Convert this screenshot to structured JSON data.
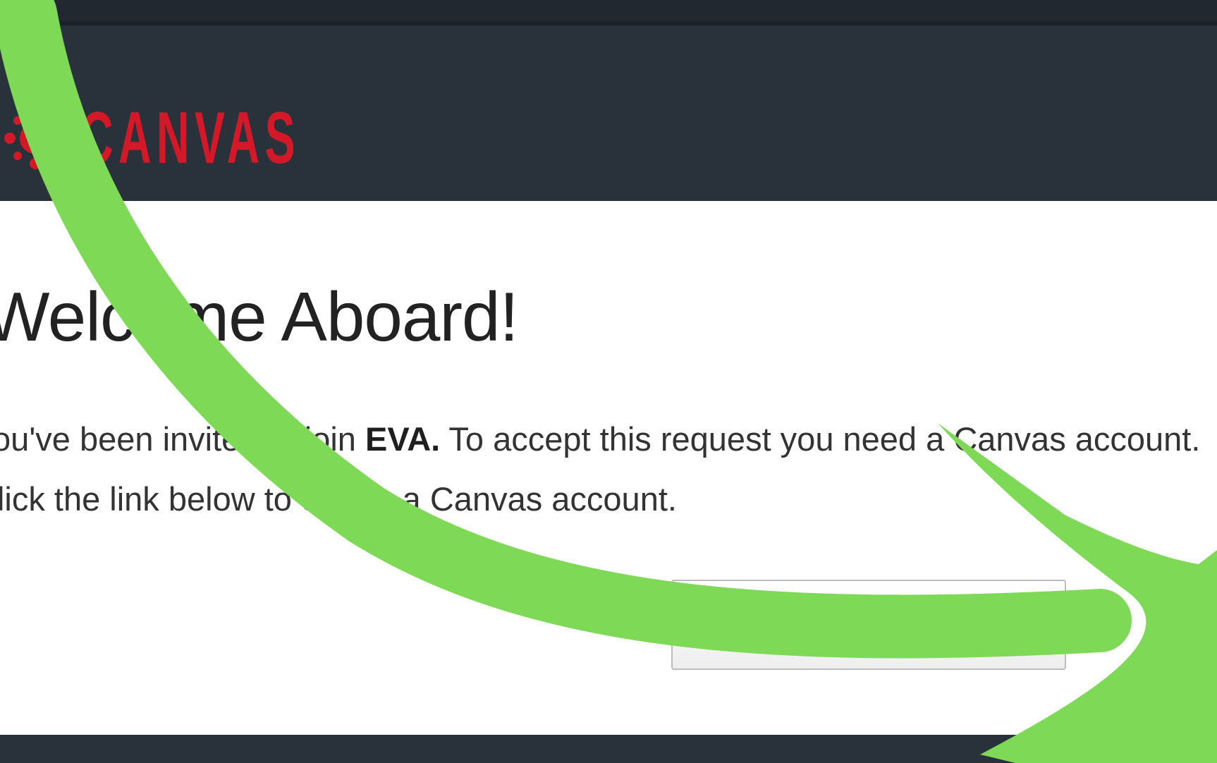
{
  "header": {
    "logo_text": "CANVAS",
    "brand_color": "#d31828",
    "background_color": "#29323b"
  },
  "main": {
    "title": "Welcome Aboard!",
    "invite": {
      "line1_prefix": "You've been invited to join ",
      "course_name": "EVA.",
      "line1_suffix": " To accept this request you need a Canvas account.",
      "line2": "Click the link below to create a Canvas account."
    },
    "buttons": {
      "left_label": "",
      "right_label": ""
    }
  },
  "annotation": {
    "arrow_color": "#7ed957"
  }
}
